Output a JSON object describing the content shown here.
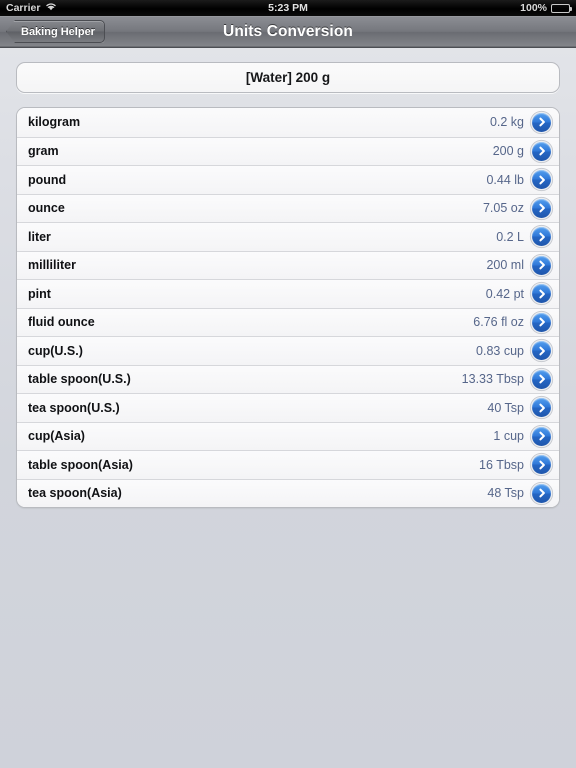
{
  "status_bar": {
    "carrier": "Carrier",
    "wifi_icon": "wifi-icon",
    "time": "5:23 PM",
    "battery_percent": "100%",
    "battery_icon": "battery-full-icon"
  },
  "nav_bar": {
    "back_label": "Baking Helper",
    "title": "Units Conversion"
  },
  "header_field": {
    "text": "[Water] 200 g"
  },
  "conversion_table": {
    "disclosure_icon": "chevron-right-circle-icon",
    "rows": [
      {
        "label": "kilogram",
        "value": "0.2 kg"
      },
      {
        "label": "gram",
        "value": "200 g"
      },
      {
        "label": "pound",
        "value": "0.44 lb"
      },
      {
        "label": "ounce",
        "value": "7.05 oz"
      },
      {
        "label": "liter",
        "value": "0.2 L"
      },
      {
        "label": "milliliter",
        "value": "200 ml"
      },
      {
        "label": "pint",
        "value": "0.42 pt"
      },
      {
        "label": "fluid ounce",
        "value": "6.76 fl oz"
      },
      {
        "label": "cup(U.S.)",
        "value": "0.83 cup"
      },
      {
        "label": "table spoon(U.S.)",
        "value": "13.33 Tbsp"
      },
      {
        "label": "tea spoon(U.S.)",
        "value": "40 Tsp"
      },
      {
        "label": "cup(Asia)",
        "value": "1 cup"
      },
      {
        "label": "table spoon(Asia)",
        "value": "16 Tbsp"
      },
      {
        "label": "tea spoon(Asia)",
        "value": "48 Tsp"
      }
    ]
  },
  "colors": {
    "accent_blue": "#2f78d8",
    "value_text": "#56668a",
    "background": "#d2d5dc"
  }
}
